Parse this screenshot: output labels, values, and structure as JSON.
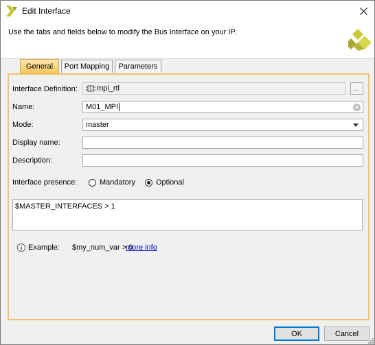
{
  "window": {
    "title": "Edit Interface",
    "description": "Use the tabs and fields below to modify the Bus Interface on your IP."
  },
  "tabs": [
    {
      "label": "General",
      "mnemonic": "G",
      "active": true
    },
    {
      "label": "Port Mapping",
      "mnemonic": "P",
      "active": false
    },
    {
      "label": "Parameters",
      "mnemonic": "a",
      "active": false
    }
  ],
  "form": {
    "interface_definition": {
      "label": "Interface Definition:",
      "value": "mpi_rtl",
      "browse_label": "..."
    },
    "name": {
      "label": "Name:",
      "value": "M01_MPI"
    },
    "mode": {
      "label": "Mode:",
      "value": "master"
    },
    "display_name": {
      "label": "Display name:",
      "value": ""
    },
    "description": {
      "label": "Description:",
      "value": ""
    },
    "presence": {
      "label": "Interface presence:",
      "options": [
        "Mandatory",
        "Optional"
      ],
      "selected": "Optional"
    },
    "expression": "$MASTER_INTERFACES > 1",
    "example": {
      "label": "Example:",
      "text": "$my_num_var > 0",
      "link": "more info"
    }
  },
  "buttons": {
    "ok": "OK",
    "cancel": "Cancel"
  },
  "colors": {
    "accent": "#f3c36c",
    "logo": "#c8c838",
    "link": "#0000cc"
  },
  "icons": [
    "xilinx-logo-icon",
    "close-icon",
    "bus-interface-icon",
    "clear-icon",
    "chevron-down-icon",
    "info-icon",
    "resize-grip-icon"
  ]
}
